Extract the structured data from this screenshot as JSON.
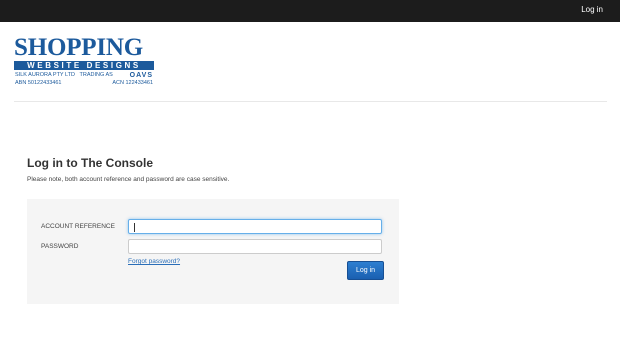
{
  "topbar": {
    "login_link": "Log in"
  },
  "logo": {
    "title": "SHOPPING",
    "bar_text": "WEBSITE DESIGNS",
    "company_line": "SILK AURORA PTY LTD",
    "trading_as": "TRADING AS",
    "trading_name": "OAVS",
    "abn": "ABN 50122433461",
    "acn": "ACN 122433461"
  },
  "login": {
    "title": "Log in to The Console",
    "note": "Please note, both account reference and password are case sensitive.",
    "account_label": "ACCOUNT REFERENCE",
    "account_value": "",
    "password_label": "PASSWORD",
    "password_value": "",
    "forgot_link": "Forgot password?",
    "submit_label": "Log in"
  },
  "colors": {
    "topbar": "#1c1c1c",
    "brand": "#1c5a9c",
    "button": "#1a5fb0",
    "link": "#2a6eb8",
    "panel": "#f5f5f5"
  }
}
